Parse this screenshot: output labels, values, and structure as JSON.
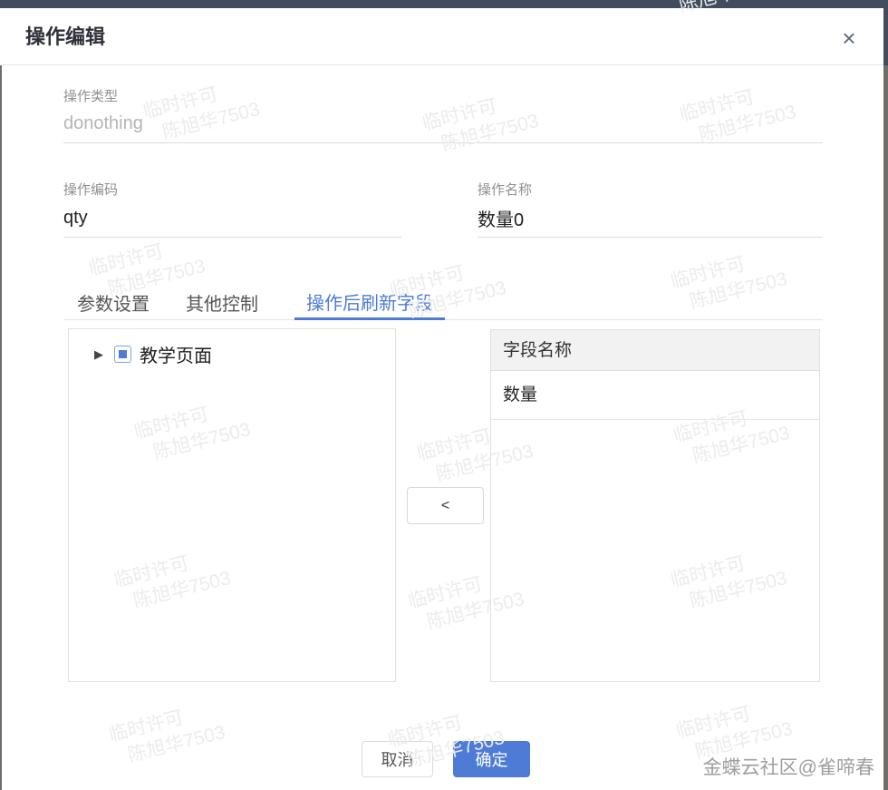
{
  "modal": {
    "title": "操作编辑",
    "close_icon": "×",
    "fields": {
      "type_label": "操作类型",
      "type_value": "donothing",
      "code_label": "操作编码",
      "code_value": "qty",
      "name_label": "操作名称",
      "name_value": "数量0"
    },
    "tabs": [
      {
        "label": "参数设置",
        "active": false
      },
      {
        "label": "其他控制",
        "active": false
      },
      {
        "label": "操作后刷新字段",
        "active": true
      }
    ],
    "tree": {
      "node_label": "教学页面"
    },
    "transfer_button": "<",
    "table": {
      "header": "字段名称",
      "rows": [
        "数量"
      ]
    },
    "footer": {
      "cancel": "取消",
      "ok": "确定"
    }
  },
  "credit": "金蝶云社区@雀啼春",
  "watermark": {
    "line1": "临时许可",
    "line2": "陈旭华7503"
  },
  "colors": {
    "accent": "#4d7bd6",
    "topbar": "#414c5e",
    "page_edge": "#6f6e69",
    "table_header_bg": "#f2f2f2"
  }
}
